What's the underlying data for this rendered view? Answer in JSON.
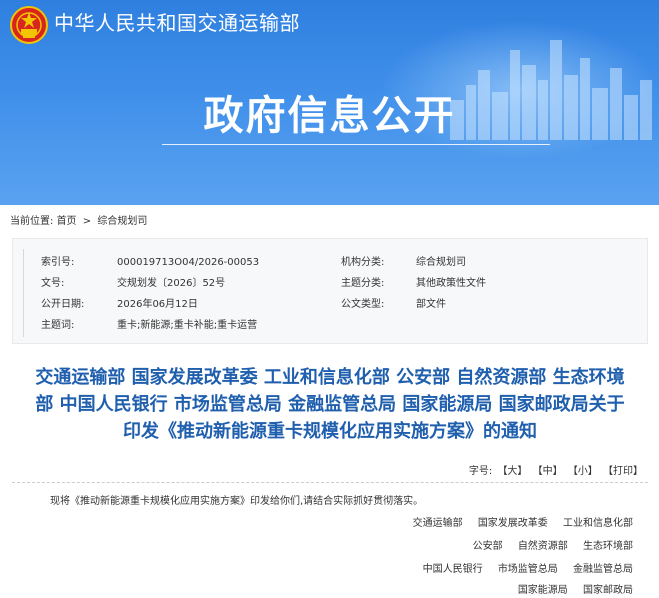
{
  "header": {
    "ministry_name": "中华人民共和国交通运输部",
    "banner_title": "政府信息公开"
  },
  "breadcrumb": {
    "prefix": "当前位置:",
    "items": [
      "首页",
      "综合规划司"
    ],
    "separator": ">"
  },
  "info_table": {
    "rows": [
      {
        "k1": "索引号:",
        "v1": "000019713O04/2026-00053",
        "k2": "机构分类:",
        "v2": "综合规划司"
      },
      {
        "k1": "文号:",
        "v1": "交规划发〔2026〕52号",
        "k2": "主题分类:",
        "v2": "其他政策性文件"
      },
      {
        "k1": "公开日期:",
        "v1": "2026年06月12日",
        "k2": "公文类型:",
        "v2": "部文件"
      },
      {
        "k1": "主题词:",
        "v1": "重卡;新能源;重卡补能;重卡运营",
        "k2": "",
        "v2": ""
      }
    ]
  },
  "article": {
    "title_lines": [
      "交通运输部 国家发展改革委 工业和信息化部 公安部 自然资源部 生态环境",
      "部 中国人民银行 市场监管总局 金融监管总局 国家能源局 国家邮政局关于",
      "印发《推动新能源重卡规模化应用实施方案》的通知"
    ],
    "font_tools": {
      "label": "字号:",
      "large": "【大】",
      "medium": "【中】",
      "small": "【小】",
      "print": "【打印】"
    },
    "body_paragraph": "现将《推动新能源重卡规模化应用实施方案》印发给你们,请结合实际抓好贯彻落实。",
    "signatories": [
      [
        "交通运输部",
        "国家发展改革委",
        "工业和信息化部"
      ],
      [
        "公安部",
        "自然资源部",
        "生态环境部"
      ],
      [
        "中国人民银行",
        "市场监管总局",
        "金融监管总局"
      ],
      [
        "国家能源局",
        "国家邮政局"
      ]
    ]
  },
  "colors": {
    "banner_blue": "#3f8fea",
    "title_blue": "#1f5fae",
    "emblem_red": "#d8251d",
    "emblem_gold": "#f5c400"
  },
  "icons": [
    "national-emblem-icon",
    "city-skyline-graphic"
  ]
}
